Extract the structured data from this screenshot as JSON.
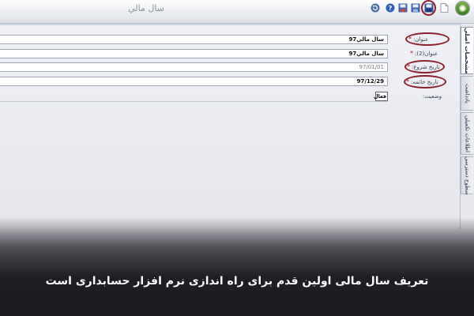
{
  "window": {
    "title": "سال مالي"
  },
  "toolbar": {
    "buttons": [
      {
        "name": "new-document-button",
        "icon": "new-document-icon"
      },
      {
        "name": "save-button",
        "icon": "save-icon"
      },
      {
        "name": "save-new-button",
        "icon": "save-new-icon"
      },
      {
        "name": "save-close-button",
        "icon": "save-close-icon"
      },
      {
        "name": "help-button",
        "icon": "help-icon"
      },
      {
        "name": "refresh-button",
        "icon": "refresh-icon"
      }
    ]
  },
  "tabs": [
    {
      "label": "مشخصات اصلی",
      "active": true
    },
    {
      "label": "یادداشت",
      "active": false
    },
    {
      "label": "اطلاعات تكميلی",
      "active": false
    },
    {
      "label": "سطوح دسترسی",
      "active": false
    }
  ],
  "form": {
    "title_label": "عنوان:",
    "title_value": "سال مالي97",
    "title2_label": "عنوان(2):",
    "title2_value": "سال مالي97",
    "start_label": "تاريخ شروع:",
    "start_value": "97/01/01",
    "end_label": "تاريخ خاتمه:",
    "end_value": "97/12/29",
    "status_label": "وضعيت:",
    "status_value": "فعال",
    "required_mark": "*"
  },
  "caption": "تعریف سال مالی اولین قدم برای راه اندازی نرم افزار حسابداری است",
  "colors": {
    "highlight_ring": "#8d1e2b",
    "required": "#c0111f",
    "caption_bg": "#1e1e25"
  }
}
